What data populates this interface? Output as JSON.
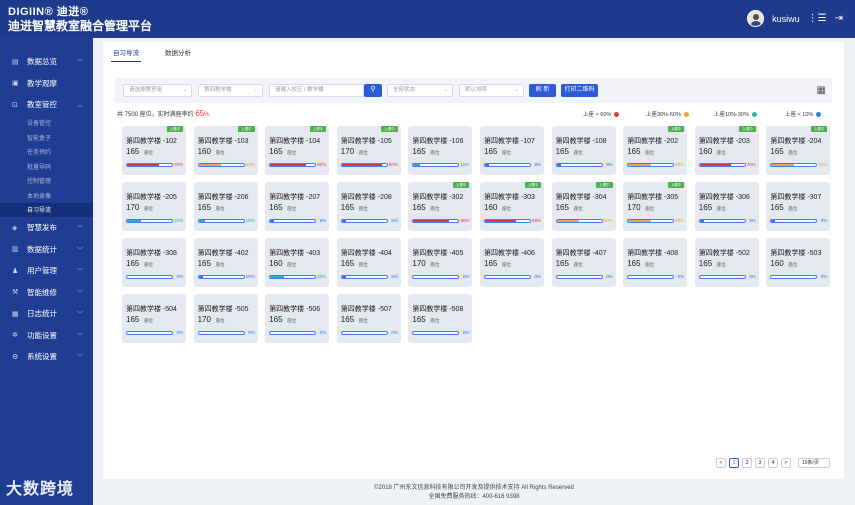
{
  "header": {
    "brand": "DIGIIN® 迪进®",
    "title": "迪进智慧教室融合管理平台",
    "username": "kusiwu",
    "user_icon": "user-list-icon",
    "logout_icon": "logout-icon"
  },
  "sidebar": {
    "items": [
      {
        "label": "数据总览",
        "icon": "dashboard-icon",
        "has_chevron": true
      },
      {
        "label": "教学观摩",
        "icon": "monitor-icon",
        "has_chevron": false
      },
      {
        "label": "教室管控",
        "icon": "classroom-icon",
        "has_chevron": true
      },
      {
        "label": "智慧发布",
        "icon": "publish-icon",
        "has_chevron": true
      },
      {
        "label": "数据统计",
        "icon": "chart-icon",
        "has_chevron": true
      },
      {
        "label": "用户管理",
        "icon": "users-icon",
        "has_chevron": true
      },
      {
        "label": "智能维修",
        "icon": "repair-icon",
        "has_chevron": true
      },
      {
        "label": "日志统计",
        "icon": "log-icon",
        "has_chevron": true
      },
      {
        "label": "功能设置",
        "icon": "settings-icon",
        "has_chevron": true
      },
      {
        "label": "系统设置",
        "icon": "gear-icon",
        "has_chevron": true
      }
    ],
    "subitems": [
      "设备管控",
      "智能盒子",
      "任务预约",
      "批量导码",
      "控制管理",
      "本地录像",
      "自习导流"
    ],
    "active_subitem": "自习导流",
    "watermark": "大数跨境"
  },
  "tabs": [
    {
      "label": "自习导流",
      "active": true
    },
    {
      "label": "数据分析",
      "active": false
    }
  ],
  "filters": {
    "classroom_placeholder": "请选择教室组",
    "building_placeholder": "第四教学楼",
    "search_placeholder": "请输入校区 / 教学楼",
    "status_placeholder": "全部状态",
    "sort_placeholder": "默认排序",
    "refresh_label": "刷 新",
    "print_label": "打印二维码"
  },
  "summary": {
    "prefix": "共 7500 座位，实时满座率约",
    "value": "65",
    "unit": "%"
  },
  "legend": [
    {
      "label": "上座 > 60%",
      "color": "#e53935"
    },
    {
      "label": "上座30%-60%",
      "color": "#f0a43a"
    },
    {
      "label": "上座10%-30%",
      "color": "#26b5a6"
    },
    {
      "label": "上座 < 10%",
      "color": "#2d7be0"
    }
  ],
  "cards": [
    {
      "name": "第四教学楼 -102",
      "seats": "165",
      "pct": "70%",
      "fill": 0.7,
      "color": "#e53935",
      "badge": "上课中"
    },
    {
      "name": "第四教学楼 -103",
      "seats": "160",
      "pct": "50%",
      "fill": 0.5,
      "color": "#f0a43a",
      "badge": "上课中"
    },
    {
      "name": "第四教学楼 -104",
      "seats": "165",
      "pct": "80%",
      "fill": 0.8,
      "color": "#e53935",
      "badge": "上课中"
    },
    {
      "name": "第四教学楼 -105",
      "seats": "170",
      "pct": "90%",
      "fill": 0.9,
      "color": "#e53935",
      "badge": "上课中"
    },
    {
      "name": "第四教学楼 -106",
      "seats": "165",
      "pct": "15%",
      "fill": 0.15,
      "color": "#26b5a6",
      "badge": ""
    },
    {
      "name": "第四教学楼 -107",
      "seats": "165",
      "pct": "9%",
      "fill": 0.09,
      "color": "#2d7be0",
      "badge": ""
    },
    {
      "name": "第四教学楼 -108",
      "seats": "165",
      "pct": "9%",
      "fill": 0.09,
      "color": "#2d7be0",
      "badge": ""
    },
    {
      "name": "第四教学楼 -202",
      "seats": "165",
      "pct": "50%",
      "fill": 0.5,
      "color": "#f0a43a",
      "badge": "上课中"
    },
    {
      "name": "第四教学楼 -203",
      "seats": "160",
      "pct": "70%",
      "fill": 0.7,
      "color": "#e53935",
      "badge": "上课中"
    },
    {
      "name": "第四教学楼 -204",
      "seats": "165",
      "pct": "50%",
      "fill": 0.5,
      "color": "#f0a43a",
      "badge": "上课中"
    },
    {
      "name": "第四教学楼 -205",
      "seats": "170",
      "pct": "30%",
      "fill": 0.3,
      "color": "#26b5a6",
      "badge": ""
    },
    {
      "name": "第四教学楼 -206",
      "seats": "165",
      "pct": "15%",
      "fill": 0.15,
      "color": "#26b5a6",
      "badge": ""
    },
    {
      "name": "第四教学楼 -207",
      "seats": "165",
      "pct": "9%",
      "fill": 0.09,
      "color": "#2d7be0",
      "badge": ""
    },
    {
      "name": "第四教学楼 -208",
      "seats": "165",
      "pct": "9%",
      "fill": 0.09,
      "color": "#2d7be0",
      "badge": ""
    },
    {
      "name": "第四教学楼 -302",
      "seats": "165",
      "pct": "80%",
      "fill": 0.8,
      "color": "#e53935",
      "badge": "上课中"
    },
    {
      "name": "第四教学楼 -303",
      "seats": "160",
      "pct": "69%",
      "fill": 0.69,
      "color": "#e53935",
      "badge": "上课中"
    },
    {
      "name": "第四教学楼 -304",
      "seats": "165",
      "pct": "50%",
      "fill": 0.5,
      "color": "#f0a43a",
      "badge": "上课中"
    },
    {
      "name": "第四教学楼 -305",
      "seats": "170",
      "pct": "50%",
      "fill": 0.5,
      "color": "#f0a43a",
      "badge": "上课中"
    },
    {
      "name": "第四教学楼 -306",
      "seats": "165",
      "pct": "9%",
      "fill": 0.09,
      "color": "#2d7be0",
      "badge": ""
    },
    {
      "name": "第四教学楼 -307",
      "seats": "165",
      "pct": "9%",
      "fill": 0.09,
      "color": "#2d7be0",
      "badge": ""
    },
    {
      "name": "第四教学楼 -308",
      "seats": "165",
      "pct": "0%",
      "fill": 0,
      "color": "#2d7be0",
      "badge": ""
    },
    {
      "name": "第四教学楼 -402",
      "seats": "165",
      "pct": "10%",
      "fill": 0.1,
      "color": "#2d7be0",
      "badge": ""
    },
    {
      "name": "第四教学楼 -403",
      "seats": "160",
      "pct": "30%",
      "fill": 0.3,
      "color": "#26b5a6",
      "badge": ""
    },
    {
      "name": "第四教学楼 -404",
      "seats": "165",
      "pct": "9%",
      "fill": 0.09,
      "color": "#2d7be0",
      "badge": ""
    },
    {
      "name": "第四教学楼 -405",
      "seats": "170",
      "pct": "0%",
      "fill": 0,
      "color": "#2d7be0",
      "badge": ""
    },
    {
      "name": "第四教学楼 -406",
      "seats": "165",
      "pct": "0%",
      "fill": 0,
      "color": "#2d7be0",
      "badge": ""
    },
    {
      "name": "第四教学楼 -407",
      "seats": "165",
      "pct": "0%",
      "fill": 0,
      "color": "#2d7be0",
      "badge": ""
    },
    {
      "name": "第四教学楼 -408",
      "seats": "165",
      "pct": "0%",
      "fill": 0,
      "color": "#2d7be0",
      "badge": ""
    },
    {
      "name": "第四教学楼 -502",
      "seats": "165",
      "pct": "0%",
      "fill": 0,
      "color": "#2d7be0",
      "badge": ""
    },
    {
      "name": "第四教学楼 -503",
      "seats": "160",
      "pct": "0%",
      "fill": 0,
      "color": "#2d7be0",
      "badge": ""
    },
    {
      "name": "第四教学楼 -504",
      "seats": "165",
      "pct": "0%",
      "fill": 0,
      "color": "#2d7be0",
      "badge": ""
    },
    {
      "name": "第四教学楼 -505",
      "seats": "170",
      "pct": "0%",
      "fill": 0,
      "color": "#2d7be0",
      "badge": ""
    },
    {
      "name": "第四教学楼 -506",
      "seats": "165",
      "pct": "0%",
      "fill": 0,
      "color": "#2d7be0",
      "badge": ""
    },
    {
      "name": "第四教学楼 -507",
      "seats": "165",
      "pct": "0%",
      "fill": 0,
      "color": "#2d7be0",
      "badge": ""
    },
    {
      "name": "第四教学楼 -508",
      "seats": "165",
      "pct": "0%",
      "fill": 0,
      "color": "#2d7be0",
      "badge": ""
    }
  ],
  "seat_unit": "座位",
  "pagination": {
    "prev": "<",
    "pages": [
      "1",
      "2",
      "3",
      "4"
    ],
    "active_page": "1",
    "next": ">",
    "page_size": "15条/页"
  },
  "footer": {
    "copyright": "©2018 广州东文信息科技有限公司开发及提供技术支持 All Rights Reserved",
    "hotline": "全国免费服务热线：400-616 9398"
  }
}
